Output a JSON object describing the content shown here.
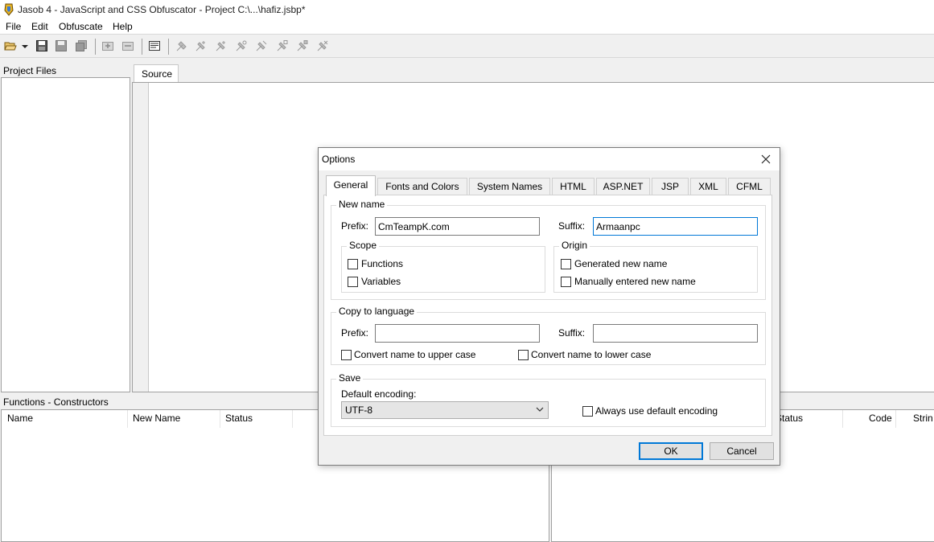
{
  "window": {
    "title": "Jasob 4 - JavaScript and CSS Obfuscator - Project  C:\\...\\hafiz.jsbp*"
  },
  "menu": {
    "items": [
      "File",
      "Edit",
      "Obfuscate",
      "Help"
    ]
  },
  "panels": {
    "project_files_label": "Project Files",
    "source_tab_label": "Source",
    "functions_label": "Functions - Constructors",
    "left_columns": [
      "Name",
      "New Name",
      "Status"
    ],
    "right_columns": [
      "Status",
      "Code",
      "Strin"
    ]
  },
  "dialog": {
    "title": "Options",
    "tabs": [
      "General",
      "Fonts and Colors",
      "System Names",
      "HTML",
      "ASP.NET",
      "JSP",
      "XML",
      "CFML"
    ],
    "active_tab": "General",
    "new_name": {
      "group_title": "New name",
      "prefix_label": "Prefix:",
      "prefix_value": "CmTeampK.com",
      "suffix_label": "Suffix:",
      "suffix_value": "Armaanpc",
      "scope": {
        "title": "Scope",
        "functions_label": "Functions",
        "functions_checked": false,
        "variables_label": "Variables",
        "variables_checked": false
      },
      "origin": {
        "title": "Origin",
        "generated_label": "Generated new name",
        "generated_checked": false,
        "manual_label": "Manually entered new name",
        "manual_checked": false
      }
    },
    "copy_to_language": {
      "group_title": "Copy to language",
      "prefix_label": "Prefix:",
      "prefix_value": "",
      "suffix_label": "Suffix:",
      "suffix_value": "",
      "upper_label": "Convert name to upper case",
      "upper_checked": false,
      "lower_label": "Convert name to lower case",
      "lower_checked": false
    },
    "save": {
      "group_title": "Save",
      "encoding_label": "Default encoding:",
      "encoding_value": "UTF-8",
      "always_default_label": "Always use default encoding",
      "always_default_checked": false
    },
    "ok_label": "OK",
    "cancel_label": "Cancel"
  },
  "colors": {
    "focus_border": "#0078d7",
    "window_bg": "#f0f0f0"
  },
  "icons": [
    "app-icon",
    "open-folder-icon",
    "dropdown-arrow-icon",
    "save-icon",
    "save-as-icon",
    "save-all-icon",
    "add-file-icon",
    "remove-file-icon",
    "properties-icon",
    "obfuscate-tool-icon",
    "close-icon",
    "chevron-down-icon"
  ]
}
